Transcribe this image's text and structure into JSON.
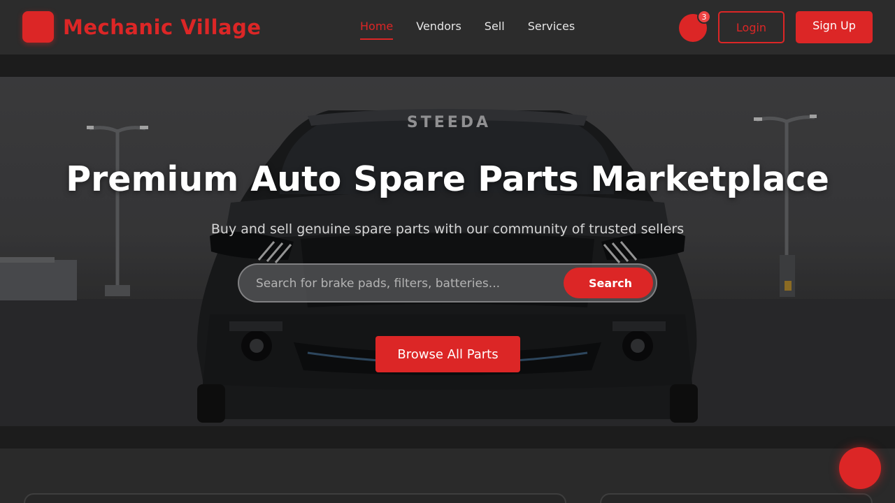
{
  "brand": {
    "name": "Mechanic Village",
    "logo_icon": "wrench-icon",
    "logo_glyph": ""
  },
  "nav": {
    "items": [
      {
        "label": "Home",
        "active": true
      },
      {
        "label": "Vendors",
        "active": false
      },
      {
        "label": "Sell",
        "active": false
      },
      {
        "label": "Services",
        "active": false
      }
    ]
  },
  "header": {
    "cart_icon": "shopping-cart-icon",
    "cart_glyph": "",
    "cart_count": "3",
    "login_label": "Login",
    "signup_label": "Sign Up"
  },
  "hero": {
    "title": "Premium Auto Spare Parts Marketplace",
    "subtitle": "Buy and sell genuine spare parts with our community of trusted sellers",
    "search_placeholder": "Search for brake pads, filters, batteries...",
    "search_value": "",
    "search_button_label": "Search",
    "search_button_glyph": "",
    "browse_button_label": "Browse All Parts",
    "windshield_text": "STEEDA"
  },
  "fab": {
    "icon": "chat-icon",
    "glyph": ""
  },
  "colors": {
    "accent": "#dc2626",
    "header_bg": "#2c2c2c",
    "page_bg": "#2a2a2a"
  }
}
